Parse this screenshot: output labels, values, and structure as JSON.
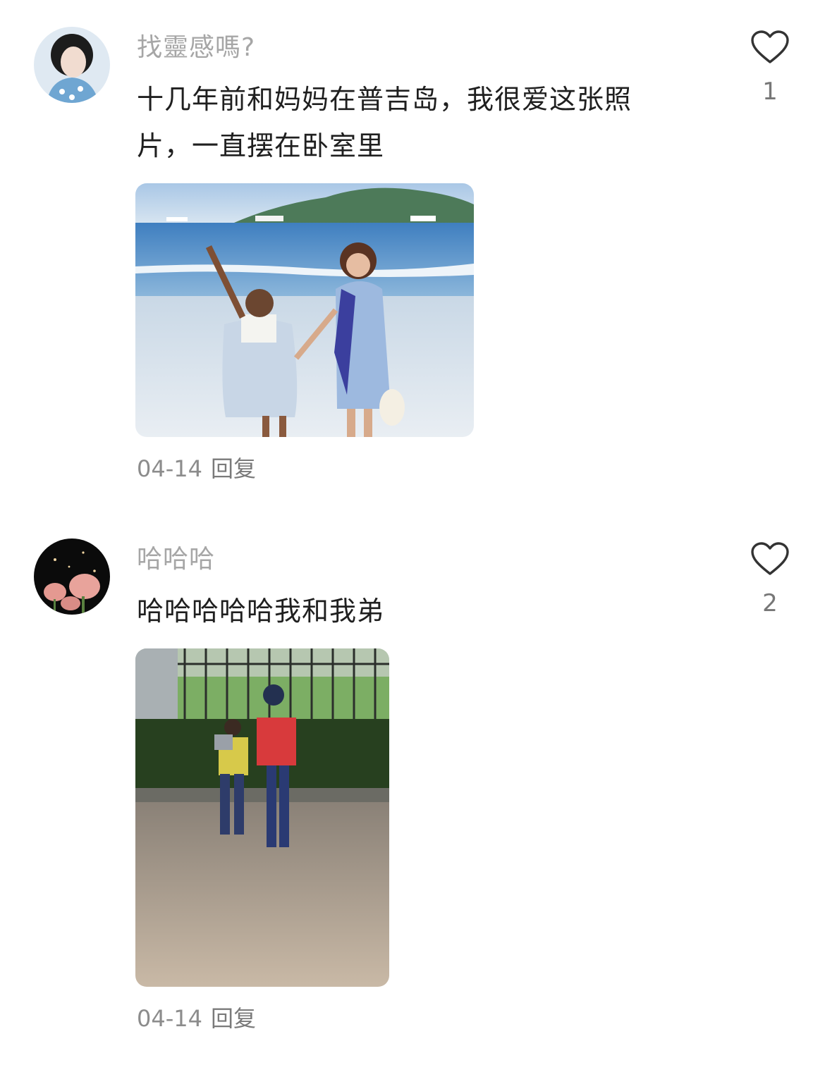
{
  "comments": [
    {
      "username": "找靈感嗎?",
      "text": "十几年前和妈妈在普吉岛，我很爱这张照片，一直摆在卧室里",
      "likes": "1",
      "date": "04-14",
      "reply_label": "回复",
      "like_icon": "heart-outline-icon"
    },
    {
      "username": "哈哈哈",
      "text": "哈哈哈哈哈我和我弟",
      "likes": "2",
      "date": "04-14",
      "reply_label": "回复",
      "like_icon": "heart-outline-icon"
    }
  ]
}
